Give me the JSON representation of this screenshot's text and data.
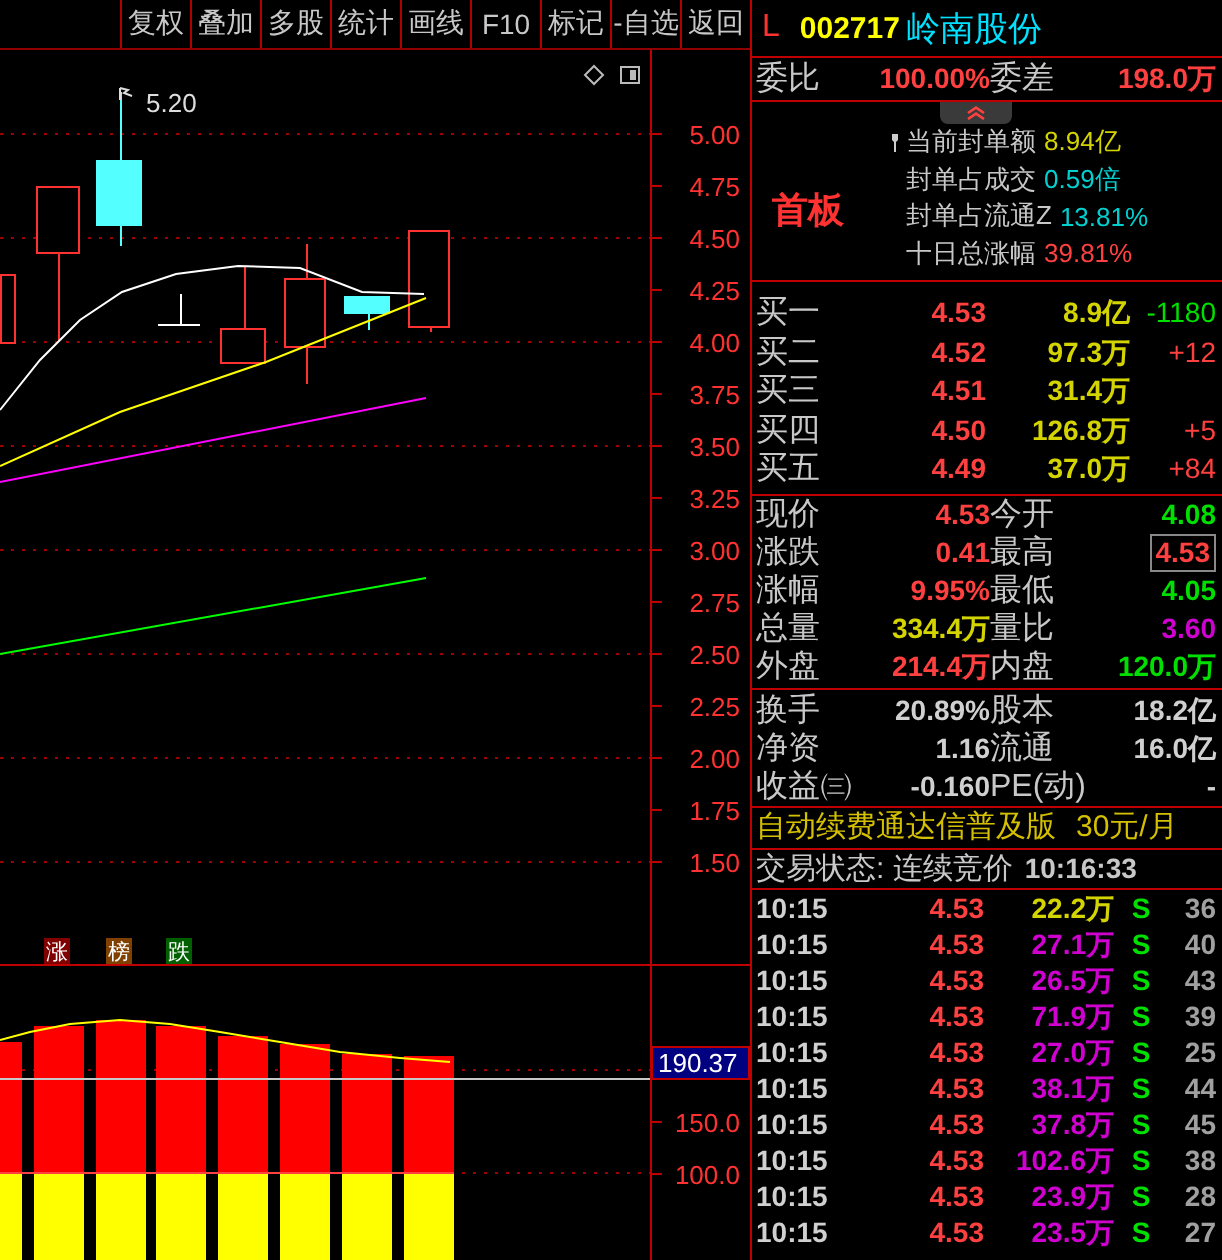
{
  "toolbar": {
    "buttons": [
      "复权",
      "叠加",
      "多股",
      "统计",
      "画线",
      "F10",
      "标记",
      "-自选",
      "返回"
    ]
  },
  "price_chart": {
    "high_label": "5.20",
    "axis_labels": [
      "5.00",
      "4.75",
      "4.50",
      "4.25",
      "4.00",
      "3.75",
      "3.50",
      "3.25",
      "3.00",
      "2.75",
      "2.50",
      "2.25",
      "2.00",
      "1.75",
      "1.50"
    ]
  },
  "indicator_tags": [
    {
      "label": "涨",
      "color": "#800000"
    },
    {
      "label": "榜",
      "color": "#804000"
    },
    {
      "label": "跌",
      "color": "#006000"
    }
  ],
  "volume_chart": {
    "current_value": "190.37",
    "axis_labels": [
      "150.0",
      "100.0"
    ]
  },
  "quote": {
    "flag": "L",
    "code": "002717",
    "name": "岭南股份"
  },
  "order_ratio": {
    "ratio_label": "委比",
    "ratio": "100.00%",
    "diff_label": "委差",
    "diff": "198.0万"
  },
  "limit_board": {
    "title": "首板",
    "items": [
      {
        "label": "当前封单额",
        "value": "8.94亿",
        "color": "#d4d400",
        "marked": true
      },
      {
        "label": "封单占成交",
        "value": "0.59倍",
        "color": "#00d0d0",
        "marked": false
      },
      {
        "label": "封单占流通Z",
        "value": "13.81%",
        "color": "#00d0d0",
        "marked": false
      },
      {
        "label": "十日总涨幅",
        "value": "39.81%",
        "color": "#ff4040",
        "marked": false
      }
    ]
  },
  "bids": [
    {
      "label": "买一",
      "price": "4.53",
      "volume": "8.9亿",
      "change": "-1180",
      "color": "#00e000"
    },
    {
      "label": "买二",
      "price": "4.52",
      "volume": "97.3万",
      "change": "+12",
      "color": "#ff4040"
    },
    {
      "label": "买三",
      "price": "4.51",
      "volume": "31.4万"
    },
    {
      "label": "买四",
      "price": "4.50",
      "volume": "126.8万",
      "change": "+5",
      "color": "#ff4040"
    },
    {
      "label": "买五",
      "price": "4.49",
      "volume": "37.0万",
      "change": "+84",
      "color": "#ff4040"
    }
  ],
  "quote_stats": [
    {
      "label": "现价",
      "value": "4.53",
      "color": "#ff4040",
      "highlighted": false
    },
    {
      "label": "今开",
      "value": "4.08",
      "color": "#00e000",
      "highlighted": false
    },
    {
      "label": "涨跌",
      "value": "0.41",
      "color": "#ff4040",
      "highlighted": false
    },
    {
      "label": "最高",
      "value": "4.53",
      "color": "#ff4040",
      "highlighted": true
    },
    {
      "label": "涨幅",
      "value": "9.95%",
      "color": "#ff4040",
      "highlighted": false
    },
    {
      "label": "最低",
      "value": "4.05",
      "color": "#00e000",
      "highlighted": false
    },
    {
      "label": "总量",
      "value": "334.4万",
      "color": "#d4d400",
      "highlighted": false
    },
    {
      "label": "量比",
      "value": "3.60",
      "color": "#d000d0",
      "highlighted": false
    },
    {
      "label": "外盘",
      "value": "214.4万",
      "color": "#ff4040",
      "highlighted": false
    },
    {
      "label": "内盘",
      "value": "120.0万",
      "color": "#00e000",
      "highlighted": false
    }
  ],
  "share_stats": [
    {
      "label": "换手",
      "value": "20.89%"
    },
    {
      "label": "股本",
      "value": "18.2亿"
    },
    {
      "label": "净资",
      "value": "1.16"
    },
    {
      "label": "流通",
      "value": "16.0亿"
    },
    {
      "label": "收益㈢",
      "value": "-0.160"
    },
    {
      "label": "PE(动)",
      "value": "-"
    }
  ],
  "promo": {
    "text": "自动续费通达信普及版",
    "price": "30元/月"
  },
  "trade_status": {
    "text": "交易状态: 连续竞价",
    "time": "10:16:33"
  },
  "ticks": [
    {
      "time": "10:15",
      "price": "4.53",
      "volume": "22.2万",
      "color": "#d4d400",
      "side": "S",
      "count": "36"
    },
    {
      "time": "10:15",
      "price": "4.53",
      "volume": "27.1万",
      "color": "#d000d0",
      "side": "S",
      "count": "40"
    },
    {
      "time": "10:15",
      "price": "4.53",
      "volume": "26.5万",
      "color": "#d000d0",
      "side": "S",
      "count": "43"
    },
    {
      "time": "10:15",
      "price": "4.53",
      "volume": "71.9万",
      "color": "#d000d0",
      "side": "S",
      "count": "39"
    },
    {
      "time": "10:15",
      "price": "4.53",
      "volume": "27.0万",
      "color": "#d000d0",
      "side": "S",
      "count": "25"
    },
    {
      "time": "10:15",
      "price": "4.53",
      "volume": "38.1万",
      "color": "#d000d0",
      "side": "S",
      "count": "44"
    },
    {
      "time": "10:15",
      "price": "4.53",
      "volume": "37.8万",
      "color": "#d000d0",
      "side": "S",
      "count": "45"
    },
    {
      "time": "10:15",
      "price": "4.53",
      "volume": "102.6万",
      "color": "#d000d0",
      "side": "S",
      "count": "38"
    },
    {
      "time": "10:15",
      "price": "4.53",
      "volume": "23.9万",
      "color": "#d000d0",
      "side": "S",
      "count": "28"
    },
    {
      "time": "10:15",
      "price": "4.53",
      "volume": "23.5万",
      "color": "#d000d0",
      "side": "S",
      "count": "27"
    }
  ]
}
